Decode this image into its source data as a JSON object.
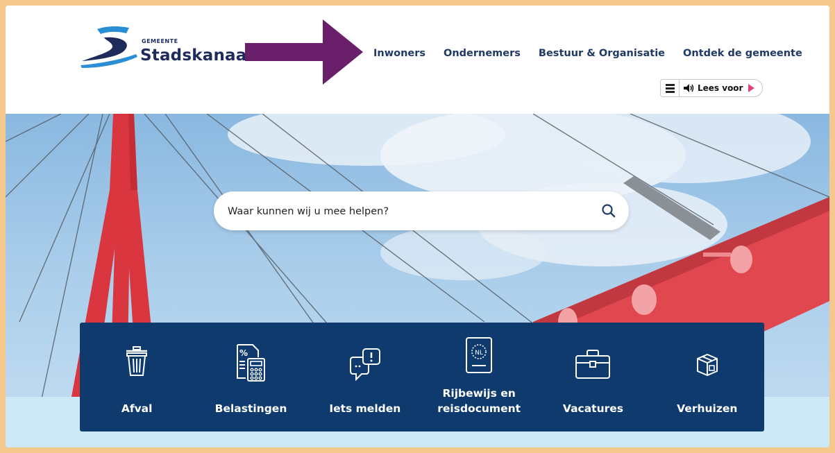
{
  "logo": {
    "small": "GEMEENTE",
    "big": "Stadskanaal"
  },
  "nav": [
    {
      "label": "Inwoners"
    },
    {
      "label": "Ondernemers"
    },
    {
      "label": "Bestuur & Organisatie"
    },
    {
      "label": "Ontdek de gemeente"
    }
  ],
  "readspeaker": {
    "label": "Lees voor",
    "menu_icon": "menu-icon",
    "speaker_icon": "speaker-icon",
    "play_icon": "play-icon"
  },
  "search": {
    "placeholder": "Waar kunnen wij u mee helpen?",
    "icon": "search-icon"
  },
  "tiles": [
    {
      "label": "Afval",
      "icon": "trash-icon"
    },
    {
      "label": "Belastingen",
      "icon": "calculator-icon"
    },
    {
      "label": "Iets melden",
      "icon": "chat-alert-icon"
    },
    {
      "label_line1": "Rijbewijs en",
      "label_line2": "reisdocument",
      "icon": "passport-icon"
    },
    {
      "label": "Vacatures",
      "icon": "briefcase-icon"
    },
    {
      "label": "Verhuizen",
      "icon": "box-icon"
    }
  ],
  "colors": {
    "brand_navy": "#0e3a6e",
    "nav_text": "#1f3a66",
    "arrow_purple": "#6a1f6b",
    "frame": "#f5c98e",
    "bridge_red": "#e0474f"
  }
}
